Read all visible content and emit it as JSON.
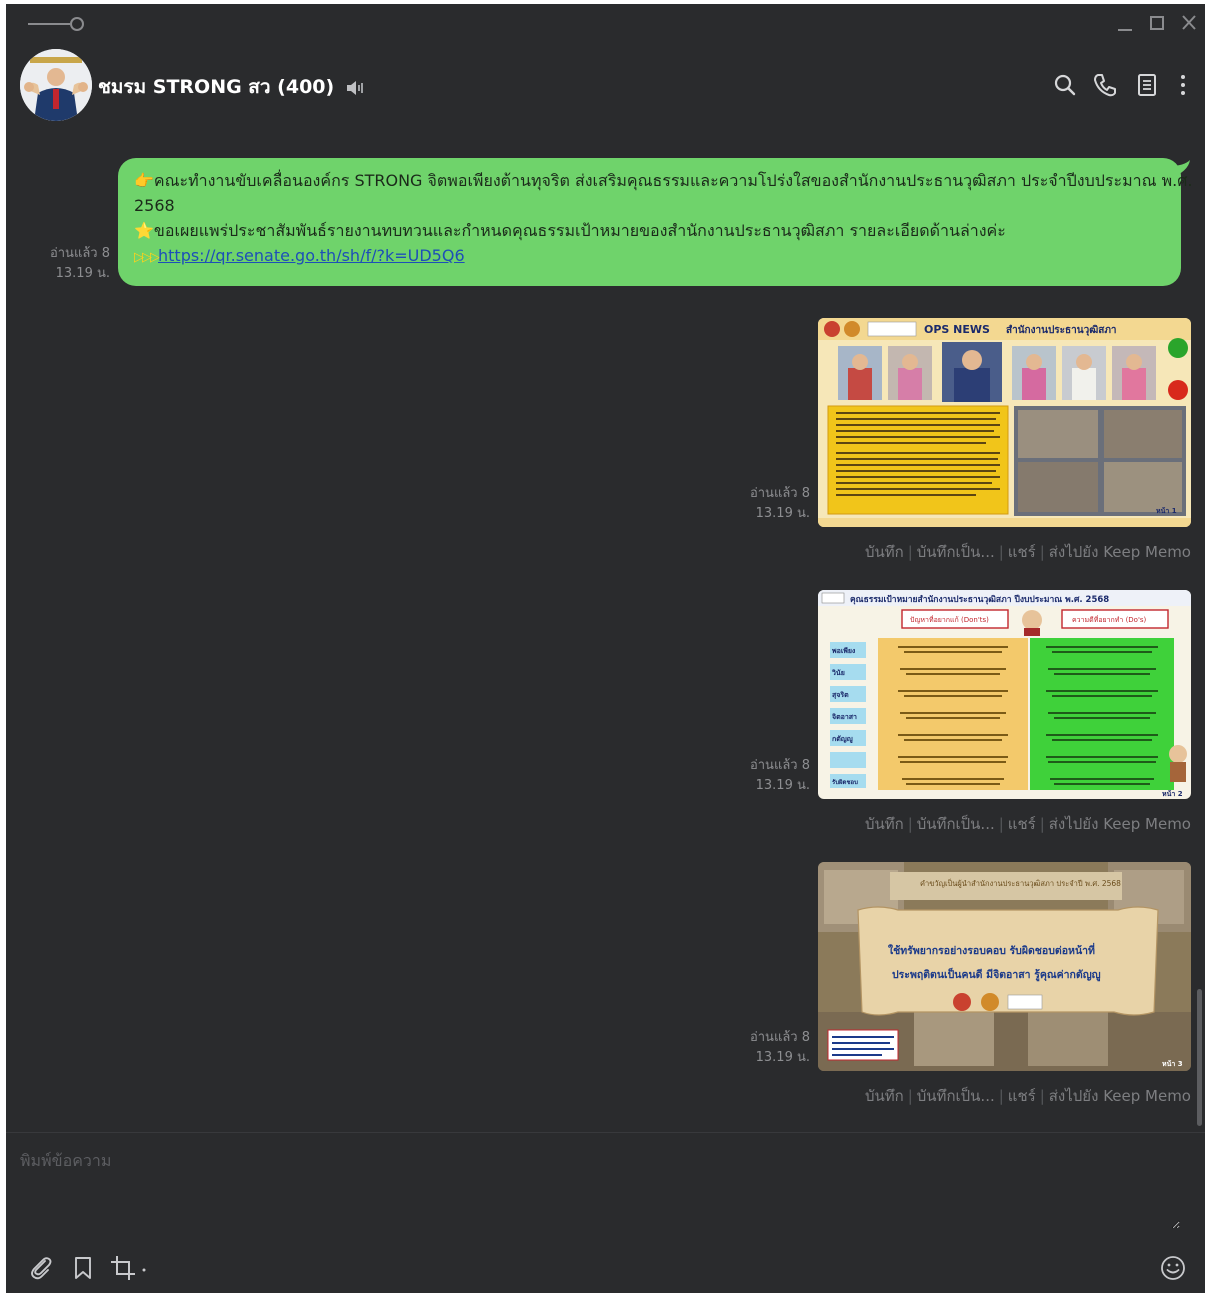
{
  "header": {
    "chat_title": "ชมรม STRONG สว (400)"
  },
  "colors": {
    "window_bg": "#2a2b2d",
    "bubble_bg": "#6fd36b",
    "link": "#1d4fb8",
    "meta_text": "#8d8e91"
  },
  "message": {
    "line1": "คณะทำงานขับเคลื่อนองค์กร STRONG จิตพอเพียงต้านทุจริต ส่งเสริมคุณธรรมและความโปร่งใสของสำนักงานประธานวุฒิสภา ประจำปีงบประมาณ พ.ศ.",
    "line2": "2568",
    "line3": "ขอเผยแพร่ประชาสัมพันธ์รายงานทบทวนและกำหนดคุณธรรมเป้าหมายของสำนักงานประธานวุฒิสภา รายละเอียดด้านล่างค่ะ",
    "link": "https://qr.senate.go.th/sh/f/?k=UD5Q6",
    "read_status": "อ่านแล้ว 8",
    "time": "13.19 น."
  },
  "images": [
    {
      "read_status": "อ่านแล้ว 8",
      "time": "13.19 น.",
      "caption_left": "OPS NEWS",
      "caption_right": "สำนักงานประธานวุฒิสภา",
      "page": "หน้า 1",
      "actions": [
        "บันทึก",
        "บันทึกเป็น...",
        "แชร์",
        "ส่งไปยัง Keep Memo"
      ]
    },
    {
      "read_status": "อ่านแล้ว 8",
      "time": "13.19 น.",
      "caption": "คุณธรรมเป้าหมายสำนักงานประธานวุฒิสภา ปีงบประมาณ พ.ศ. 2568",
      "left_header": "ปัญหาที่อยากแก้ (Don'ts)",
      "right_header": "ความดีที่อยากทำ (Do's)",
      "rows": [
        "พอเพียง",
        "วินัย",
        "สุจริต",
        "จิตอาสา",
        "กตัญญู",
        "",
        "รับผิดชอบ"
      ],
      "page": "หน้า 2",
      "actions": [
        "บันทึก",
        "บันทึกเป็น...",
        "แชร์",
        "ส่งไปยัง Keep Memo"
      ]
    },
    {
      "read_status": "อ่านแล้ว 8",
      "time": "13.19 น.",
      "banner": "คำขวัญเป็นผู้นำสำนักงานประธานวุฒิสภา ประจำปี พ.ศ. 2568",
      "slogan_line1": "ใช้ทรัพยากรอย่างรอบคอบ รับผิดชอบต่อหน้าที่",
      "slogan_line2": "ประพฤติตนเป็นคนดี มีจิตอาสา รู้คุณค่ากตัญญู",
      "page": "หน้า 3",
      "actions": [
        "บันทึก",
        "บันทึกเป็น...",
        "แชร์",
        "ส่งไปยัง Keep Memo"
      ]
    }
  ],
  "composer": {
    "placeholder": "พิมพ์ข้อความ"
  }
}
